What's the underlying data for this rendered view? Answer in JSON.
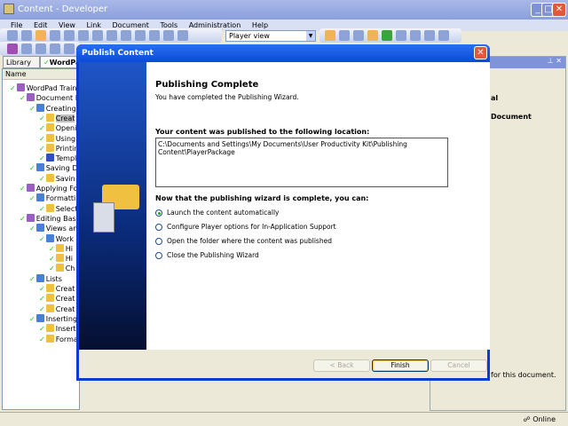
{
  "window": {
    "title": "Content - Developer"
  },
  "menu": [
    "File",
    "Edit",
    "View",
    "Link",
    "Document",
    "Tools",
    "Administration",
    "Help"
  ],
  "toolbar": {
    "view_select": "Player view"
  },
  "tabs": [
    "Library",
    "WordPad"
  ],
  "tree": {
    "column": "Name",
    "rows": [
      {
        "label": "WordPad Training",
        "level": 0,
        "type": "book"
      },
      {
        "label": "Document Ba",
        "level": 1,
        "type": "book"
      },
      {
        "label": "Creating",
        "level": 2,
        "type": "module"
      },
      {
        "label": "Creat",
        "level": 3,
        "type": "topic",
        "selected": true
      },
      {
        "label": "Openi",
        "level": 3,
        "type": "topic"
      },
      {
        "label": "Using",
        "level": 3,
        "type": "topic"
      },
      {
        "label": "Printin",
        "level": 3,
        "type": "topic"
      },
      {
        "label": "Templ",
        "level": 3,
        "type": "doc"
      },
      {
        "label": "Saving Do",
        "level": 2,
        "type": "module"
      },
      {
        "label": "Savin",
        "level": 3,
        "type": "topic"
      },
      {
        "label": "Applying Form",
        "level": 1,
        "type": "book"
      },
      {
        "label": "Formattin",
        "level": 2,
        "type": "module"
      },
      {
        "label": "Select",
        "level": 3,
        "type": "topic"
      },
      {
        "label": "Editing Basics",
        "level": 1,
        "type": "book"
      },
      {
        "label": "Views and",
        "level": 2,
        "type": "module"
      },
      {
        "label": "Work",
        "level": 3,
        "type": "module"
      },
      {
        "label": "Hi",
        "level": 4,
        "type": "topic"
      },
      {
        "label": "Hi",
        "level": 4,
        "type": "topic"
      },
      {
        "label": "Ch",
        "level": 4,
        "type": "topic"
      },
      {
        "label": "Lists",
        "level": 2,
        "type": "module"
      },
      {
        "label": "Creat",
        "level": 3,
        "type": "topic"
      },
      {
        "label": "Creat",
        "level": 3,
        "type": "topic"
      },
      {
        "label": "Creat",
        "level": 3,
        "type": "topic"
      },
      {
        "label": "Inserting",
        "level": 2,
        "type": "module"
      },
      {
        "label": "Insert",
        "level": 3,
        "type": "topic"
      },
      {
        "label": "Forma",
        "level": 3,
        "type": "topic"
      }
    ]
  },
  "right_pane": {
    "line1": "al",
    "line2": "Document",
    "footer": "for this document."
  },
  "status": {
    "online": "Online"
  },
  "dialog": {
    "title": "Publish Content",
    "heading": "Publishing Complete",
    "subheading": "You have completed the Publishing Wizard.",
    "location_label": "Your content was published to the following location:",
    "location": "C:\\Documents and Settings\\My Documents\\User Productivity Kit\\Publishing Content\\PlayerPackage",
    "options_label": "Now that the publishing wizard is complete, you can:",
    "options": [
      {
        "label": "Launch the content automatically",
        "selected": true
      },
      {
        "label": "Configure Player options for In-Application Support",
        "selected": false
      },
      {
        "label": "Open the folder where the content was published",
        "selected": false
      },
      {
        "label": "Close the Publishing Wizard",
        "selected": false
      }
    ],
    "buttons": {
      "back": "< Back",
      "finish": "Finish",
      "cancel": "Cancel"
    }
  }
}
